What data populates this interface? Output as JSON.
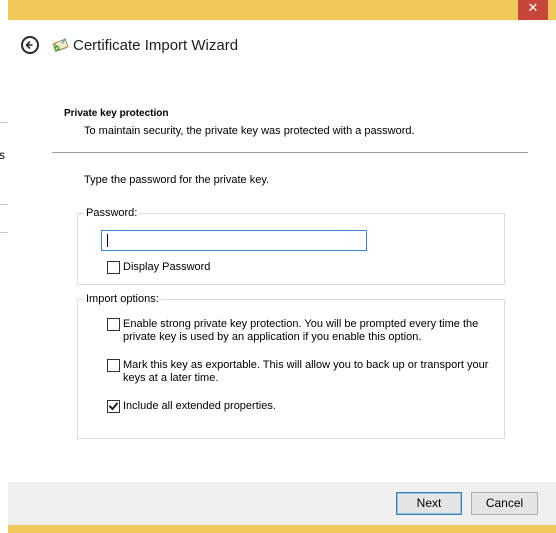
{
  "background_window": {
    "fragment_text": "s"
  },
  "titlebar": {
    "close_glyph": "✕",
    "title": "Certificate Import Wizard"
  },
  "header": {
    "title": "Private key protection",
    "description": "To maintain security, the private key was protected with a password."
  },
  "prompt": "Type the password for the private key.",
  "password_group": {
    "label": "Password:",
    "input_value": "",
    "display_password_label": "Display Password",
    "display_password_checked": false
  },
  "import_options": {
    "label": "Import options:",
    "options": [
      {
        "line1": "Enable strong private key protection. You will be prompted every time the",
        "line2": "private key is used by an application if you enable this option.",
        "checked": false
      },
      {
        "line1": "Mark this key as exportable. This will allow you to back up or transport your",
        "line2": "keys at a later time.",
        "checked": false
      },
      {
        "line1": "Include all extended properties.",
        "line2": "",
        "checked": true
      }
    ]
  },
  "footer": {
    "next_label": "Next",
    "cancel_label": "Cancel"
  },
  "colors": {
    "window_frame": "#f0c95a",
    "close_button": "#c7463c",
    "input_focus_border": "#3d84cc"
  },
  "icons": {
    "back": "back-arrow-icon",
    "wizard": "certificate-wizard-icon",
    "check": "checkmark-icon"
  }
}
